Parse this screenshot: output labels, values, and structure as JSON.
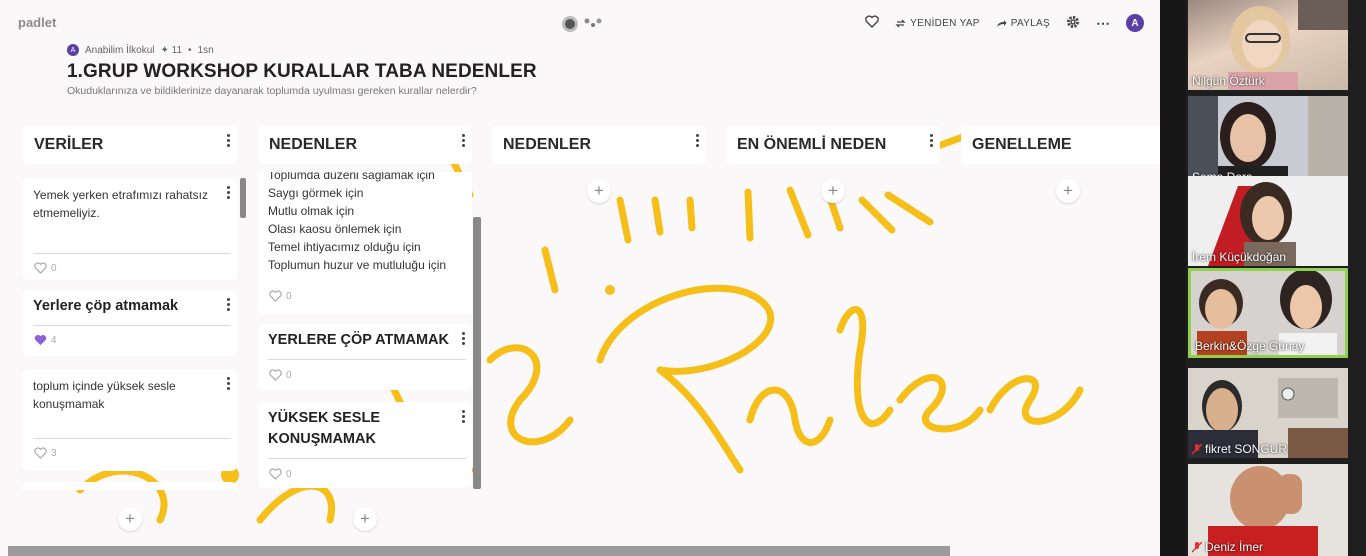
{
  "app": {
    "brand": "padlet",
    "actions": {
      "remake": "YENİDEN YAP",
      "share": "PAYLAŞ"
    },
    "user_initial": "A"
  },
  "board": {
    "author": "Anabilim İlkokul",
    "plus_count": "11",
    "age": "1sn",
    "author_initial": "A",
    "title": "1.GRUP WORKSHOP KURALLAR TABA NEDENLER",
    "subtitle": "Okuduklarınıza ve bildiklerinize dayanarak toplumda uyulması gereken kurallar nelerdir?",
    "background_text": "Golden Rules"
  },
  "columns": [
    {
      "title": "VERİLER",
      "cards": [
        {
          "text": "Yemek yerken etrafımızı rahatsız etmemeliyiz.",
          "likes": "0",
          "liked": false
        },
        {
          "text": "Yerlere çöp atmamak",
          "likes": "4",
          "liked": true
        },
        {
          "text": "toplum içinde yüksek sesle konuşmamak",
          "likes": "3",
          "liked": false
        }
      ]
    },
    {
      "title": "NEDENLER",
      "cards": [
        {
          "lines": [
            "Toplumda düzeni sağlamak için",
            "Saygı görmek için",
            "Mutlu olmak için",
            "Olası kaosu önlemek için",
            "Temel ihtiyacımız olduğu için",
            "Toplumun huzur ve mutluluğu için"
          ],
          "likes": "0",
          "liked": false
        },
        {
          "text": "YERLERE ÇÖP ATMAMAK",
          "likes": "0",
          "liked": false
        },
        {
          "text": "YÜKSEK SESLE KONUŞMAMAK",
          "likes": "0",
          "liked": false
        }
      ]
    },
    {
      "title": "NEDENLER",
      "cards": []
    },
    {
      "title": "EN ÖNEMLİ NEDEN",
      "cards": []
    },
    {
      "title": "GENELLEME",
      "cards": []
    }
  ],
  "participants": [
    {
      "name": "Nilgün Öztürk",
      "muted": false,
      "active": false
    },
    {
      "name": "Sema Dora",
      "muted": false,
      "active": false
    },
    {
      "name": "İrem Küçükdoğan",
      "muted": false,
      "active": false
    },
    {
      "name": "Berkin&Özge Günay",
      "muted": false,
      "active": true
    },
    {
      "name": "fikret SONGUR",
      "muted": true,
      "active": false
    },
    {
      "name": "Deniz İmer",
      "muted": true,
      "active": false
    }
  ],
  "colors": {
    "accent": "#5b3fa6",
    "art": "#f5b800",
    "active_tile_border": "#8fd14f",
    "muted_icon": "#e0312d"
  },
  "icons": [
    "heart-icon",
    "remake-icon",
    "share-icon",
    "gear-icon",
    "more-icon",
    "plus-icon",
    "mic-off-icon"
  ]
}
